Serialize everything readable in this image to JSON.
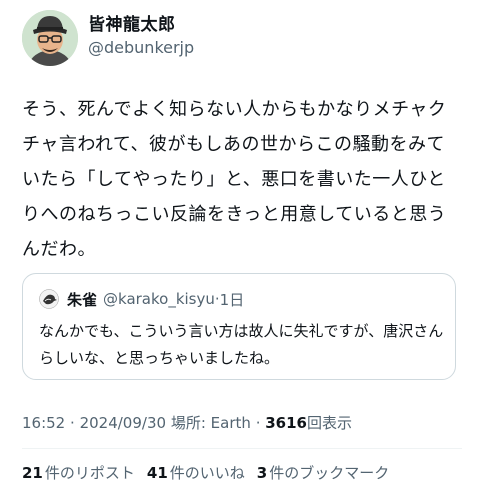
{
  "author": {
    "display_name": "皆神龍太郎",
    "handle": "@debunkerjp"
  },
  "tweet": {
    "text": "そう、死んでよく知らない人からもかなりメチャクチャ言われて、彼がもしあの世からこの騒動をみていたら「してやったり」と、悪口を書いた一人ひとりへのねちっこい反論をきっと用意していると思うんだわ。"
  },
  "quote": {
    "name": "朱雀",
    "handle": "@karako_kisyu",
    "age": "1日",
    "text": "なんかでも、こういう言い方は故人に失礼ですが、唐沢さんらしいな、と思っちゃいましたね。"
  },
  "meta": {
    "time": "16:52",
    "date": "2024/09/30",
    "location_label": "場所:",
    "location": "Earth",
    "views": "3616",
    "views_label": "回表示"
  },
  "stats": {
    "reposts_count": "21",
    "reposts_label": "件のリポスト",
    "likes_count": "41",
    "likes_label": "件のいいね",
    "bookmarks_count": "3",
    "bookmarks_label": "件のブックマーク"
  }
}
